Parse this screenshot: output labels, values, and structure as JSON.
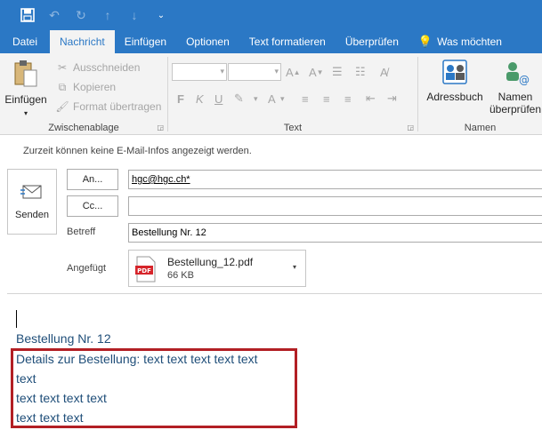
{
  "quick_access": {
    "save_icon": "save-icon",
    "undo_icon": "undo-icon",
    "redo_icon": "redo-icon",
    "up_icon": "arrow-up-icon",
    "down_icon": "arrow-down-icon",
    "customize_icon": "customize-icon"
  },
  "tabs": [
    {
      "label": "Datei"
    },
    {
      "label": "Nachricht"
    },
    {
      "label": "Einfügen"
    },
    {
      "label": "Optionen"
    },
    {
      "label": "Text formatieren"
    },
    {
      "label": "Überprüfen"
    },
    {
      "label": "Was möchten"
    }
  ],
  "ribbon": {
    "clipboard": {
      "paste": "Einfügen",
      "cut": "Ausschneiden",
      "copy": "Kopieren",
      "format_painter": "Format übertragen",
      "group_label": "Zwischenablage"
    },
    "text": {
      "group_label": "Text"
    },
    "names": {
      "address_book": "Adressbuch",
      "check_names_1": "Namen",
      "check_names_2": "überprüfen",
      "group_label": "Namen"
    }
  },
  "infobar": {
    "text": "Zurzeit können keine E-Mail-Infos angezeigt werden."
  },
  "compose": {
    "send": "Senden",
    "to_button": "An...",
    "cc_button": "Cc...",
    "to_value": "hgc@hgc.ch*",
    "cc_value": "",
    "subject_label": "Betreff",
    "subject_value": "Bestellung Nr. 12",
    "attached_label": "Angefügt",
    "attachment": {
      "name": "Bestellung_12.pdf",
      "size": "66 KB",
      "type_label": "PDF"
    }
  },
  "body": {
    "lines": [
      "Bestellung Nr. 12",
      "Details zur Bestellung: text text text text text",
      "text",
      "text text text text",
      "text text text"
    ]
  },
  "colors": {
    "titlebar": "#2b78c5",
    "ribbon_bg": "#f3f3f3",
    "body_text": "#1f4e79",
    "highlight_border": "#b21f24"
  }
}
